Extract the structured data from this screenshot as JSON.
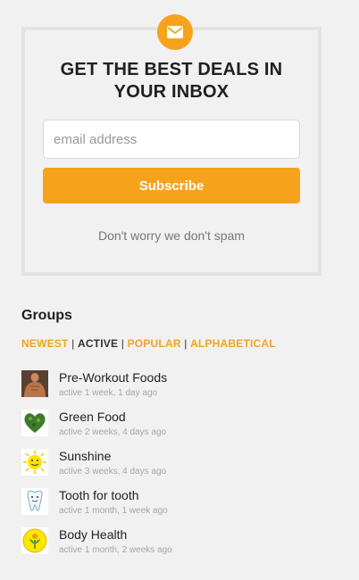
{
  "newsletter": {
    "icon": "envelope-icon",
    "accent_color": "#f7a21b",
    "title": "GET THE BEST DEALS IN YOUR INBOX",
    "email_placeholder": "email address",
    "email_value": "",
    "subscribe_label": "Subscribe",
    "spam_note": "Don't worry we don't spam"
  },
  "groups": {
    "title": "Groups",
    "filters": [
      {
        "label": "NEWEST",
        "selected": false
      },
      {
        "label": "ACTIVE",
        "selected": true
      },
      {
        "label": "POPULAR",
        "selected": false
      },
      {
        "label": "ALPHABETICAL",
        "selected": false
      }
    ],
    "separator": "|",
    "items": [
      {
        "name": "Pre-Workout Foods",
        "active": "active 1 week, 1 day ago",
        "icon": "bodybuilder-avatar"
      },
      {
        "name": "Green Food",
        "active": "active 2 weeks, 4 days ago",
        "icon": "green-heart-avatar"
      },
      {
        "name": "Sunshine",
        "active": "active 3 weeks, 4 days ago",
        "icon": "sun-avatar"
      },
      {
        "name": "Tooth for tooth",
        "active": "active 1 month, 1 week ago",
        "icon": "tooth-avatar"
      },
      {
        "name": "Body Health",
        "active": "active 1 month, 2 weeks ago",
        "icon": "flower-avatar"
      }
    ]
  }
}
